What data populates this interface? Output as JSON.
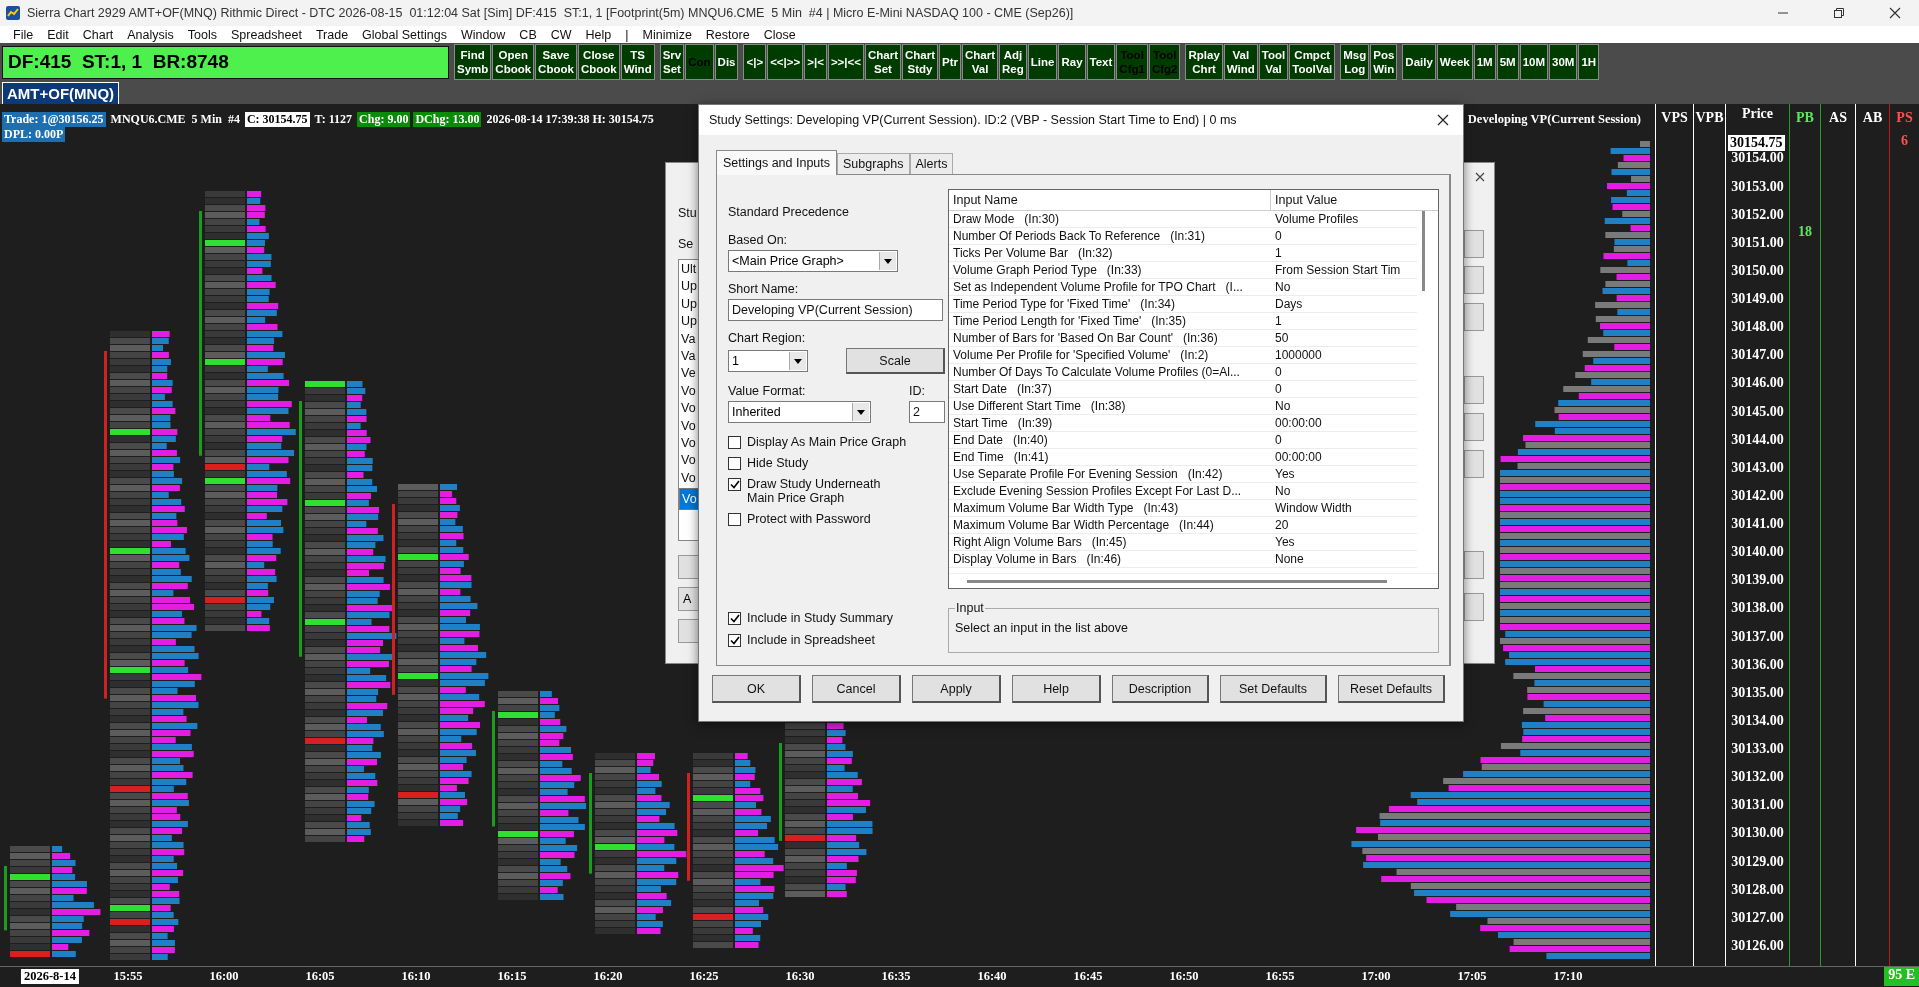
{
  "window": {
    "title": "Sierra Chart 2929 AMT+OF(MNQ) Rithmic Direct - DTC 2026-08-15  01:12:04 Sat [Sim] DF:415  ST:1, 1 [Footprint(5m) MNQU6.CME  5 Min  #4 | Micro E-Mini NASDAQ 100 - CME (Sep26)]"
  },
  "menu": [
    "File",
    "Edit",
    "Chart",
    "Analysis",
    "Tools",
    "Spreadsheet",
    "Trade",
    "Global Settings",
    "Window",
    "CB",
    "CW",
    "Help",
    "|",
    "Minimize",
    "Restore",
    "Close"
  ],
  "status_box": "DF:415  ST:1, 1  BR:8748",
  "toolbar": [
    [
      {
        "lines": [
          "Find",
          "Symb"
        ],
        "disabled": false
      },
      {
        "lines": [
          "Open",
          "Cbook"
        ],
        "disabled": false
      },
      {
        "lines": [
          "Save",
          "Cbook"
        ],
        "disabled": false
      },
      {
        "lines": [
          "Close",
          "Cbook"
        ],
        "disabled": false
      },
      {
        "lines": [
          "TS",
          "Wind"
        ],
        "disabled": false
      }
    ],
    [
      {
        "lines": [
          "Srv",
          "Set"
        ],
        "disabled": false
      },
      {
        "lines": [
          "Con"
        ],
        "disabled": true
      },
      {
        "lines": [
          "Dis"
        ],
        "disabled": false
      }
    ],
    [
      {
        "lines": [
          "<|>"
        ],
        "disabled": false
      },
      {
        "lines": [
          "<<|>>"
        ],
        "disabled": false
      },
      {
        "lines": [
          ">|<"
        ],
        "disabled": false
      },
      {
        "lines": [
          ">>|<<"
        ],
        "disabled": false
      },
      {
        "lines": [
          "Chart",
          "Set"
        ],
        "disabled": false
      },
      {
        "lines": [
          "Chart",
          "Stdy"
        ],
        "disabled": false
      },
      {
        "lines": [
          "Ptr"
        ],
        "disabled": false
      },
      {
        "lines": [
          "Chart",
          "Val"
        ],
        "disabled": false
      },
      {
        "lines": [
          "Adj",
          "Reg"
        ],
        "disabled": false
      },
      {
        "lines": [
          "Line"
        ],
        "disabled": false
      },
      {
        "lines": [
          "Ray"
        ],
        "disabled": false
      },
      {
        "lines": [
          "Text"
        ],
        "disabled": false
      },
      {
        "lines": [
          "Tool",
          "Cfg1"
        ],
        "disabled": true
      },
      {
        "lines": [
          "Tool",
          "Cfg2"
        ],
        "disabled": true
      }
    ],
    [
      {
        "lines": [
          "Rplay",
          "Chrt"
        ],
        "disabled": false
      },
      {
        "lines": [
          "Val",
          "Wind"
        ],
        "disabled": false
      },
      {
        "lines": [
          "Tool",
          "Val"
        ],
        "disabled": false
      },
      {
        "lines": [
          "Cmpct",
          "ToolVal"
        ],
        "disabled": false
      }
    ],
    [
      {
        "lines": [
          "Msg",
          "Log"
        ],
        "disabled": false
      },
      {
        "lines": [
          "Pos",
          "Win"
        ],
        "disabled": false
      }
    ],
    [
      {
        "lines": [
          "Daily"
        ],
        "disabled": false
      },
      {
        "lines": [
          "Week"
        ],
        "disabled": false
      },
      {
        "lines": [
          "1M"
        ],
        "disabled": false
      },
      {
        "lines": [
          "5M"
        ],
        "disabled": false
      },
      {
        "lines": [
          "10M"
        ],
        "disabled": false
      },
      {
        "lines": [
          "30M"
        ],
        "disabled": false
      },
      {
        "lines": [
          "1H"
        ],
        "disabled": false
      }
    ]
  ],
  "chart": {
    "symbol_tab": "AMT+OF(MNQ)",
    "info": [
      {
        "text": "Trade: 1@30156.25",
        "kind": "blue"
      },
      {
        "text": "MNQU6.CME  5 Min  #4",
        "kind": "plain"
      },
      {
        "text": "C: 30154.75",
        "kind": "white"
      },
      {
        "text": "T: 1127",
        "kind": "plain"
      },
      {
        "text": "Chg: 9.00",
        "kind": "green"
      },
      {
        "text": "DChg: 13.00",
        "kind": "green"
      },
      {
        "text": "2026-08-14 17:39:38 H: 30154.75",
        "kind": "plain"
      }
    ],
    "info_line2": {
      "text": "DPL: 0.00P",
      "kind": "blue"
    },
    "study_label": "Developing VP(Current Session)",
    "columns": [
      {
        "label": "VPS",
        "color": "#ffffff"
      },
      {
        "label": "VPB",
        "color": "#ffffff"
      },
      {
        "label": "Price",
        "color": "#ffffff"
      },
      {
        "label": "PB",
        "color": "#5ee65e",
        "marker": "18"
      },
      {
        "label": "AS",
        "color": "#ffffff"
      },
      {
        "label": "AB",
        "color": "#ffffff"
      },
      {
        "label": "PS",
        "color": "#ff5050",
        "marker": "6"
      }
    ],
    "current_price": "30154.75",
    "prices": [
      "30154.00",
      "30153.00",
      "30152.00",
      "30151.00",
      "30150.00",
      "30149.00",
      "30148.00",
      "30147.00",
      "30146.00",
      "30145.00",
      "30144.00",
      "30143.00",
      "30142.00",
      "30141.00",
      "30140.00",
      "30139.00",
      "30138.00",
      "30137.00",
      "30136.00",
      "30135.00",
      "30134.00",
      "30133.00",
      "30132.00",
      "30131.00",
      "30130.00",
      "30129.00",
      "30128.00",
      "30127.00",
      "30126.00"
    ],
    "status_badge": "95 E",
    "time_axis": [
      "2026-8-14",
      "15:55",
      "16:00",
      "16:05",
      "16:10",
      "16:15",
      "16:20",
      "16:25",
      "16:30",
      "16:35",
      "16:40",
      "16:45",
      "16:50",
      "16:55",
      "17:00",
      "17:05",
      "17:10"
    ]
  },
  "back_dialog": {
    "labels": [
      "Stu",
      "Se"
    ],
    "list": [
      {
        "text": "Ult",
        "selected": false
      },
      {
        "text": "Up",
        "selected": false
      },
      {
        "text": "Up",
        "selected": false
      },
      {
        "text": "Up",
        "selected": false
      },
      {
        "text": "Va",
        "selected": false
      },
      {
        "text": "Va",
        "selected": false
      },
      {
        "text": "Ve",
        "selected": false
      },
      {
        "text": "Vo",
        "selected": false
      },
      {
        "text": "Vo",
        "selected": false
      },
      {
        "text": "Vo",
        "selected": false
      },
      {
        "text": "Vo",
        "selected": false
      },
      {
        "text": "Vo",
        "selected": false
      },
      {
        "text": "Vo",
        "selected": false
      },
      {
        "text": "Vo",
        "selected": true
      }
    ],
    "button_fragment": "A"
  },
  "dialog": {
    "title": "Study Settings: Developing VP(Current Session). ID:2 (VBP - Session Start Time to End) | 0 ms",
    "tabs": [
      {
        "label": "Settings and Inputs",
        "selected": true
      },
      {
        "label": "Subgraphs",
        "selected": false
      },
      {
        "label": "Alerts",
        "selected": false
      }
    ],
    "precedence": "Standard Precedence",
    "based_on": {
      "label": "Based On:",
      "value": "<Main Price Graph>"
    },
    "short_name": {
      "label": "Short Name:",
      "value": "Developing VP(Current Session)"
    },
    "chart_region": {
      "label": "Chart Region:",
      "value": "1"
    },
    "scale_button": "Scale",
    "value_format": {
      "label": "Value Format:",
      "value": "Inherited"
    },
    "id": {
      "label": "ID:",
      "value": "2"
    },
    "checkboxes": [
      {
        "label": "Display As Main Price Graph",
        "checked": false
      },
      {
        "label": "Hide Study",
        "checked": false
      },
      {
        "label": "Draw Study Underneath Main Price Graph",
        "checked": true
      },
      {
        "label": "Protect with Password",
        "checked": false
      }
    ],
    "checkboxes_bottom": [
      {
        "label": "Include in Study Summary",
        "checked": true
      },
      {
        "label": "Include in Spreadsheet",
        "checked": true
      }
    ],
    "inputs": {
      "columns": [
        "Input Name",
        "Input Value"
      ],
      "rows": [
        {
          "name": "Draw Mode   (In:30)",
          "value": "Volume Profiles"
        },
        {
          "name": "Number Of Periods Back To Reference   (In:31)",
          "value": "0"
        },
        {
          "name": "Ticks Per Volume Bar   (In:32)",
          "value": "1"
        },
        {
          "name": "Volume Graph Period Type   (In:33)",
          "value": "From Session Start Tim"
        },
        {
          "name": "Set as Independent Volume Profile for TPO Chart   (I...",
          "value": "No"
        },
        {
          "name": "Time Period Type for 'Fixed Time'   (In:34)",
          "value": "Days"
        },
        {
          "name": "Time Period Length for 'Fixed Time'   (In:35)",
          "value": "1"
        },
        {
          "name": "Number of Bars for 'Based On Bar Count'   (In:36)",
          "value": "50"
        },
        {
          "name": "Volume Per Profile for 'Specified Volume'   (In:2)",
          "value": "1000000"
        },
        {
          "name": "Number Of Days To Calculate Volume Profiles (0=Al...",
          "value": "0"
        },
        {
          "name": "Start Date   (In:37)",
          "value": "0"
        },
        {
          "name": "Use Different Start Time   (In:38)",
          "value": "No"
        },
        {
          "name": "Start Time   (In:39)",
          "value": "00:00:00"
        },
        {
          "name": "End Date   (In:40)",
          "value": "0"
        },
        {
          "name": "End Time   (In:41)",
          "value": "00:00:00"
        },
        {
          "name": "Use Separate Profile For Evening Session   (In:42)",
          "value": "Yes"
        },
        {
          "name": "Exclude Evening Session Profiles Except For Last D...",
          "value": "No"
        },
        {
          "name": "Maximum Volume Bar Width Type   (In:43)",
          "value": "Window Width"
        },
        {
          "name": "Maximum Volume Bar Width Percentage   (In:44)",
          "value": "20"
        },
        {
          "name": "Right Align Volume Bars   (In:45)",
          "value": "Yes"
        },
        {
          "name": "Display Volume in Bars   (In:46)",
          "value": "None"
        }
      ]
    },
    "input_box": {
      "legend": "Input",
      "text": "Select an input in the list above"
    },
    "buttons": [
      "OK",
      "Cancel",
      "Apply",
      "Help",
      "Description",
      "Set Defaults",
      "Reset Defaults"
    ]
  }
}
